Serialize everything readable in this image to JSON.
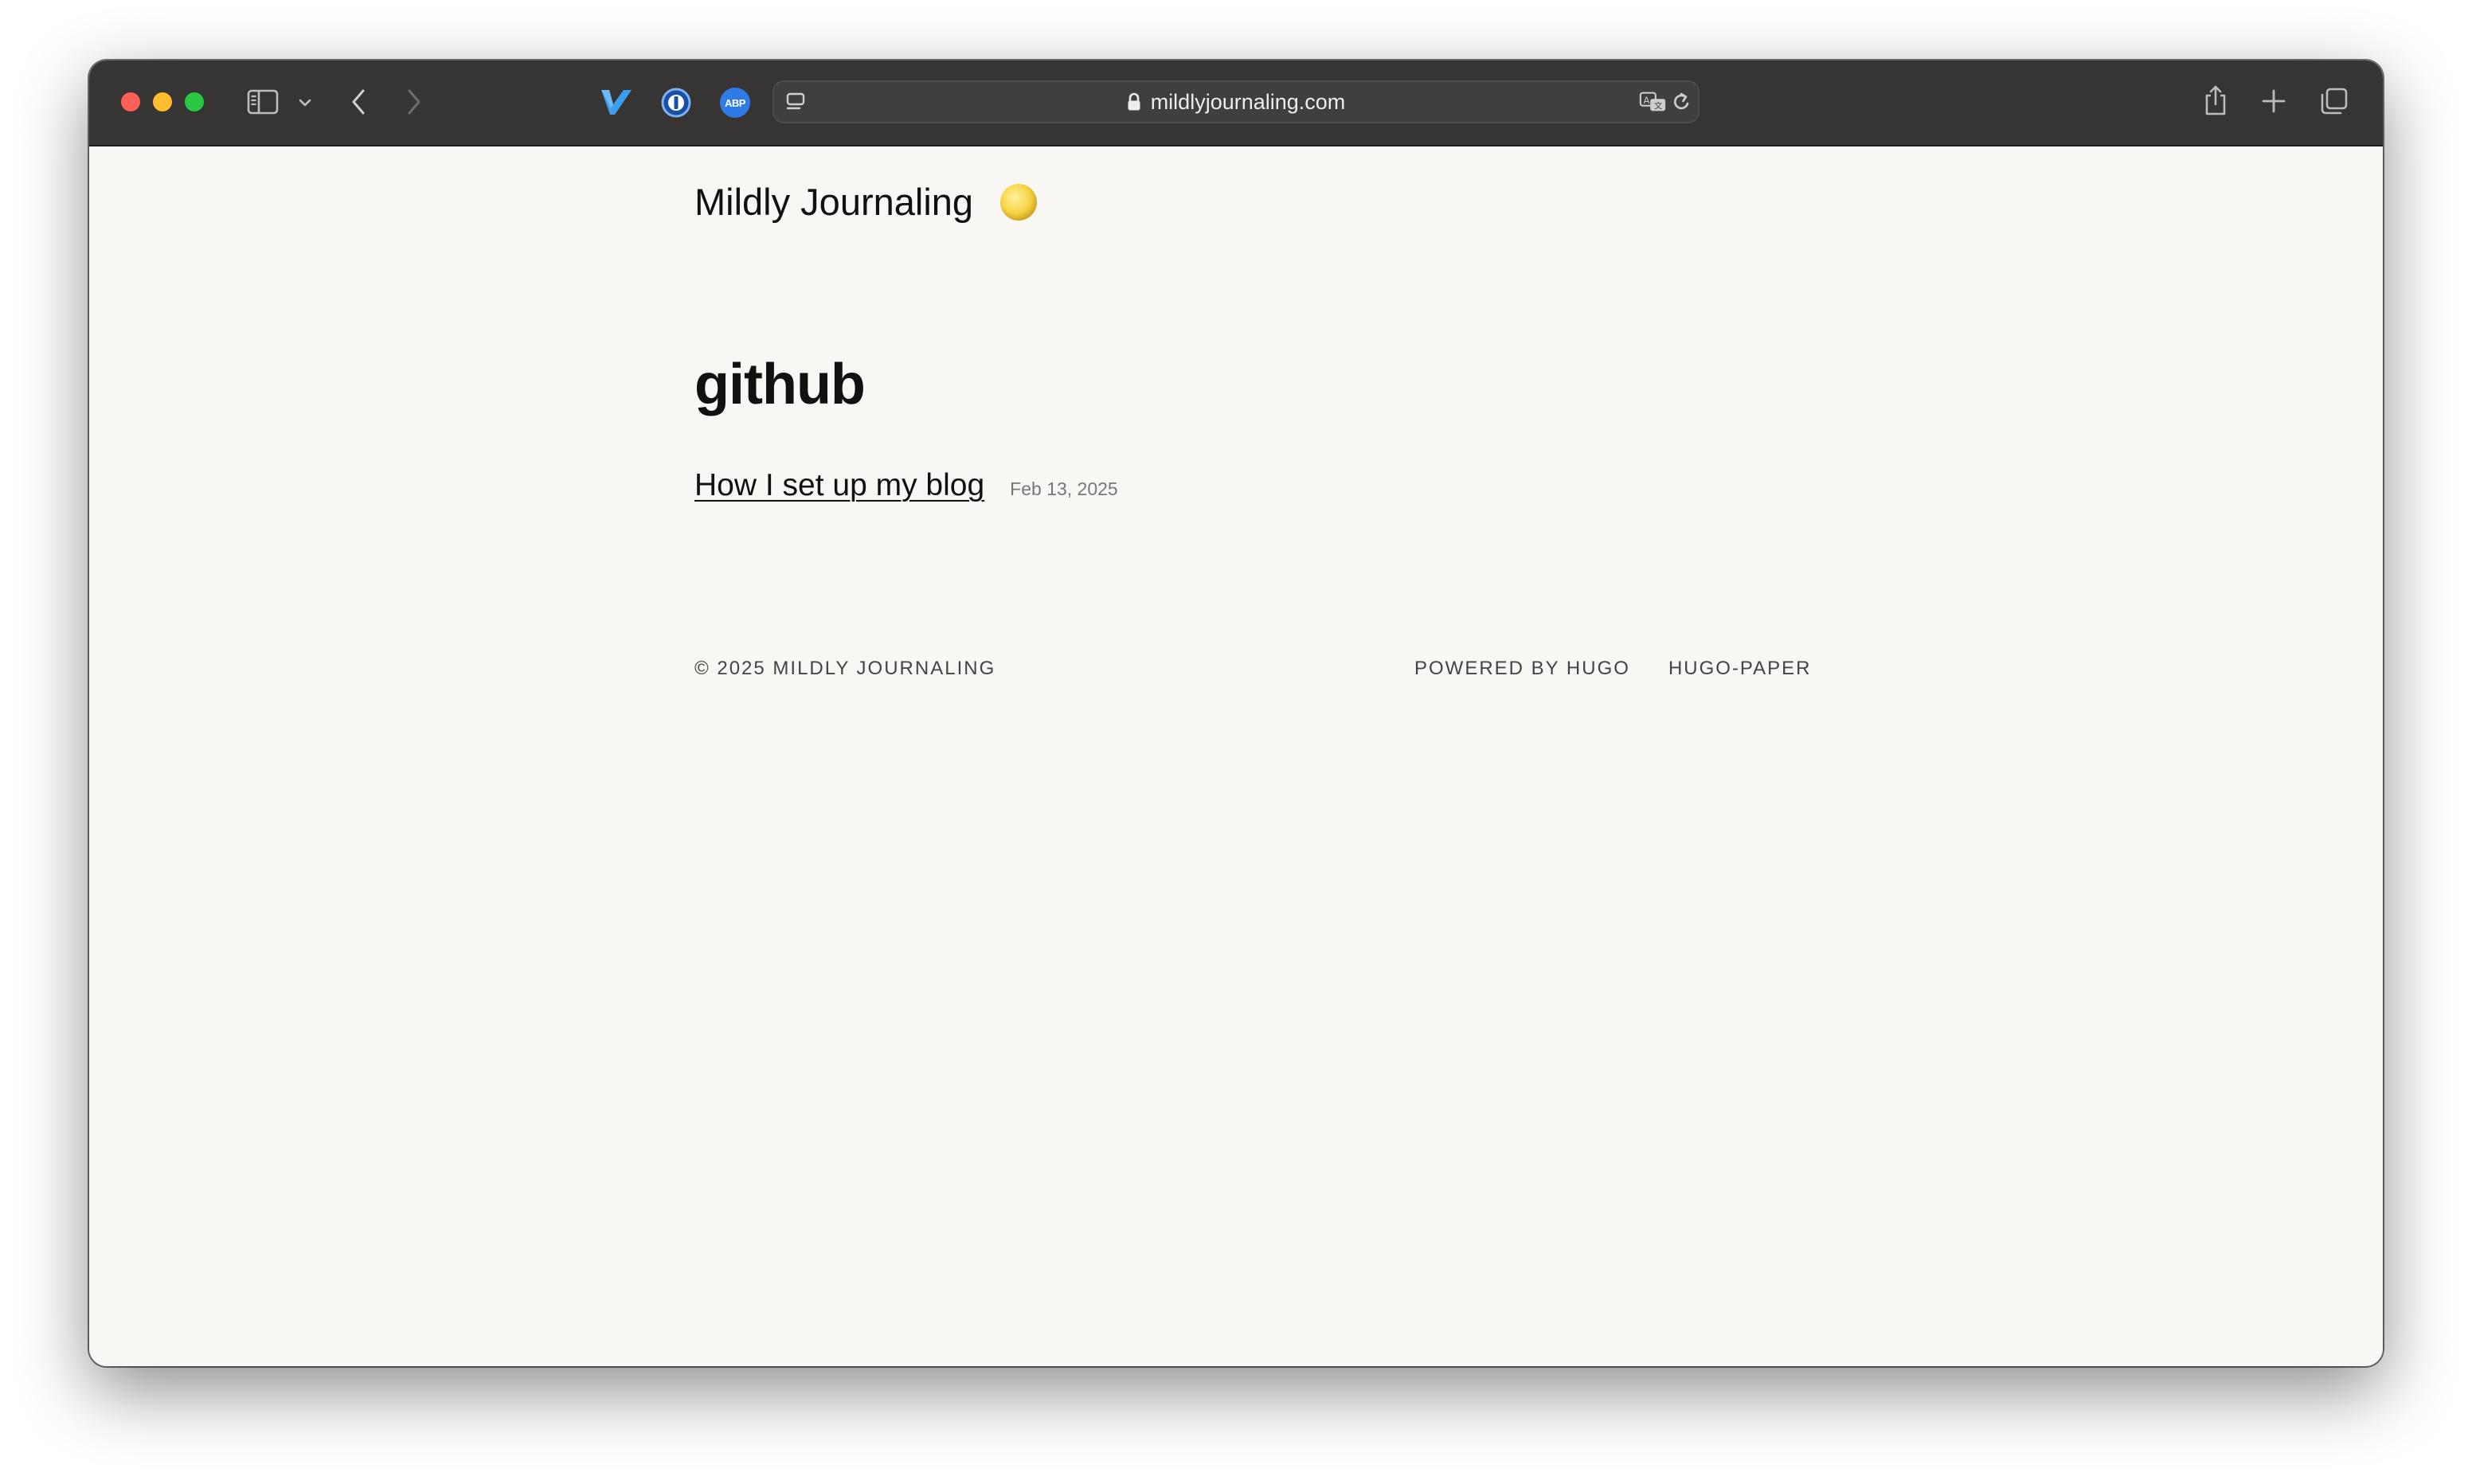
{
  "browser": {
    "url": "mildlyjournaling.com",
    "extensions": {
      "abp_label": "ABP"
    }
  },
  "site": {
    "title": "Mildly Journaling"
  },
  "main": {
    "heading": "github",
    "posts": [
      {
        "title": "How I set up my blog",
        "date": "Feb 13, 2025"
      }
    ]
  },
  "footer": {
    "copyright": "© 2025 MILDLY JOURNALING",
    "powered_by": "POWERED BY HUGO",
    "theme": "HUGO-PAPER"
  },
  "colors": {
    "toolbar": "#363533",
    "page_background": "#f8f7f3",
    "text": "#111111",
    "abp_blue": "#2f7be6",
    "vimari_blue": "#3d9ef0"
  }
}
